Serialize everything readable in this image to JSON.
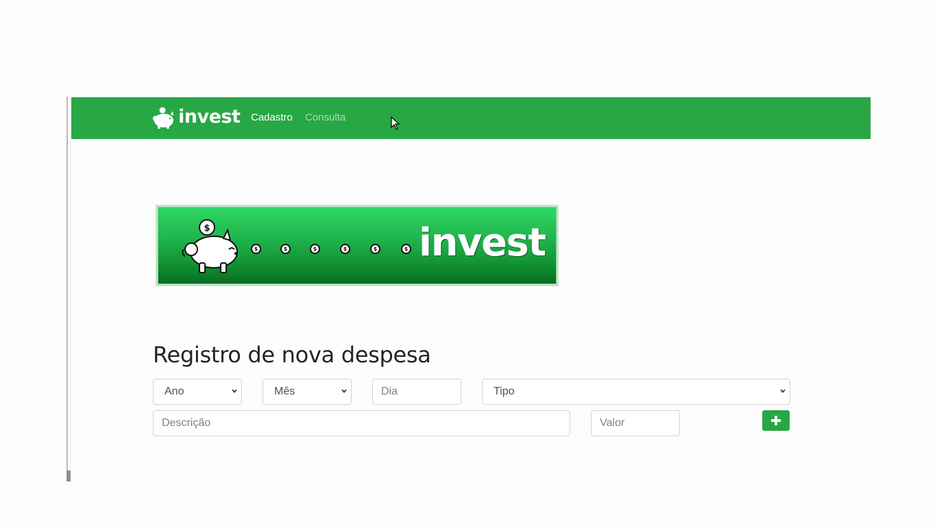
{
  "navbar": {
    "brand": "invest",
    "links": [
      {
        "label": "Cadastro",
        "active": true
      },
      {
        "label": "Consulta",
        "active": false
      }
    ]
  },
  "banner": {
    "text": "invest",
    "coin_symbol": "$"
  },
  "page": {
    "title": "Registro de nova despesa"
  },
  "form": {
    "ano": {
      "selected": "Ano"
    },
    "mes": {
      "selected": "Mês"
    },
    "dia": {
      "placeholder": "Dia"
    },
    "tipo": {
      "selected": "Tipo"
    },
    "descricao": {
      "placeholder": "Descrição"
    },
    "valor": {
      "placeholder": "Valor"
    },
    "add_button_icon": "plus-icon"
  },
  "colors": {
    "navbar": "#28a745",
    "button": "#28a745",
    "nav_inactive": "#a9dcb4"
  }
}
